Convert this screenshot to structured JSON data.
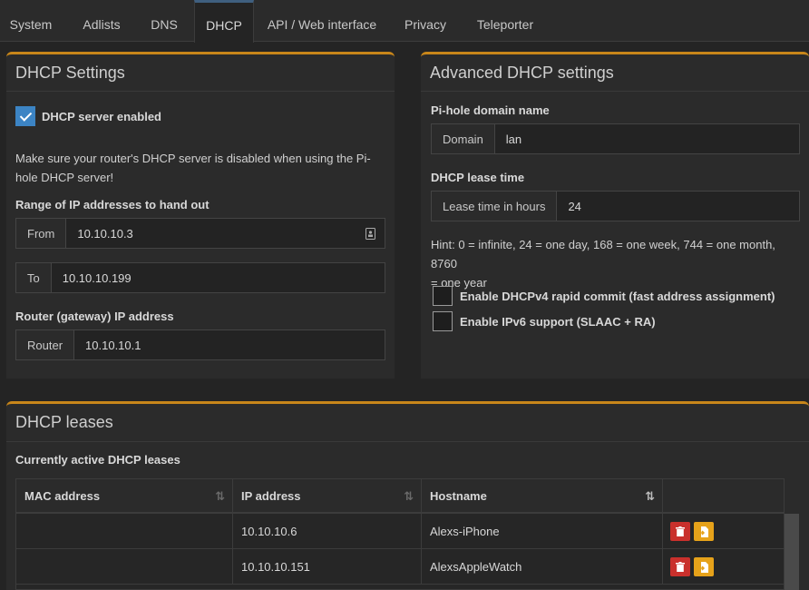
{
  "tabs": [
    "System",
    "Adlists",
    "DNS",
    "DHCP",
    "API / Web interface",
    "Privacy",
    "Teleporter"
  ],
  "dhcp_settings": {
    "title": "DHCP Settings",
    "enabled_label": "DHCP server enabled",
    "note_line1": "Make sure your router's DHCP server is disabled when using the Pi-",
    "note_line2": "hole DHCP server!",
    "range_label": "Range of IP addresses to hand out",
    "from_label": "From",
    "from_value": "10.10.10.3",
    "to_label": "To",
    "to_value": "10.10.10.199",
    "router_section": "Router (gateway) IP address",
    "router_label": "Router",
    "router_value": "10.10.10.1"
  },
  "advanced": {
    "title": "Advanced DHCP settings",
    "domain_section": "Pi-hole domain name",
    "domain_label": "Domain",
    "domain_value": "lan",
    "lease_section": "DHCP lease time",
    "lease_label": "Lease time in hours",
    "lease_value": "24",
    "hint_line1": "Hint: 0 = infinite, 24 = one day, 168 = one week, 744 = one month, 8760",
    "hint_line2": "= one year",
    "rapid_commit_label": "Enable DHCPv4 rapid commit (fast address assignment)",
    "ipv6_label": "Enable IPv6 support (SLAAC + RA)"
  },
  "leases": {
    "title": "DHCP leases",
    "subtitle": "Currently active DHCP leases",
    "columns": [
      "MAC address",
      "IP address",
      "Hostname"
    ],
    "rows": [
      {
        "mac": "",
        "ip": "10.10.10.6",
        "hostname": "Alexs-iPhone"
      },
      {
        "mac": "",
        "ip": "10.10.10.151",
        "hostname": "AlexsAppleWatch"
      }
    ]
  },
  "colors": {
    "accent_border": "#c8861a",
    "checkbox_blue": "#3c84c4",
    "delete_red": "#c9302c",
    "static_orange": "#e6a21a"
  }
}
